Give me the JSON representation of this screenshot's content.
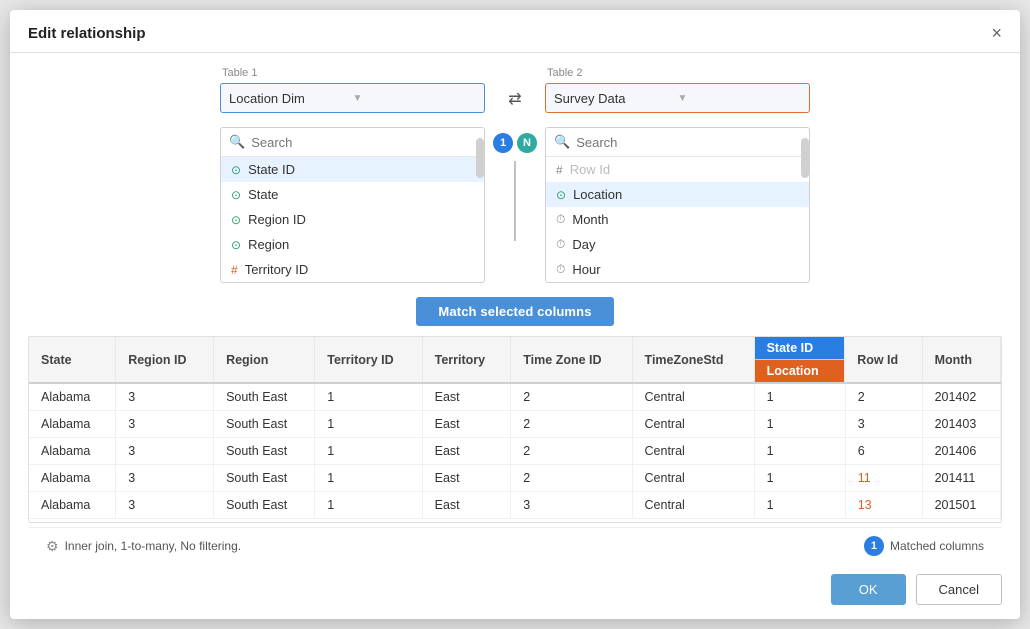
{
  "modal": {
    "title": "Edit relationship",
    "close_label": "×"
  },
  "table1": {
    "label": "Table 1",
    "value": "Location Dim"
  },
  "table2": {
    "label": "Table 2",
    "value": "Survey Data"
  },
  "left_panel": {
    "search_placeholder": "Search",
    "columns": [
      {
        "type": "geo",
        "name": "State ID"
      },
      {
        "type": "geo",
        "name": "State"
      },
      {
        "type": "geo",
        "name": "Region ID"
      },
      {
        "type": "geo",
        "name": "Region"
      },
      {
        "type": "hash",
        "name": "Territory ID"
      }
    ]
  },
  "right_panel": {
    "search_placeholder": "Search",
    "columns": [
      {
        "type": "number",
        "name": "Row Id",
        "dimmed": true
      },
      {
        "type": "geo",
        "name": "Location"
      },
      {
        "type": "clock",
        "name": "Month"
      },
      {
        "type": "clock",
        "name": "Day"
      },
      {
        "type": "clock",
        "name": "Hour"
      }
    ]
  },
  "match_button_label": "Match selected columns",
  "table_columns": [
    "State",
    "Region ID",
    "Region",
    "Territory ID",
    "Territory",
    "Time Zone ID",
    "TimeZoneStd",
    "State ID / Location",
    "Row Id",
    "Month"
  ],
  "table_rows": [
    [
      "Alabama",
      "3",
      "South East",
      "1",
      "East",
      "2",
      "Central",
      "1",
      "2",
      "201402"
    ],
    [
      "Alabama",
      "3",
      "South East",
      "1",
      "East",
      "2",
      "Central",
      "1",
      "3",
      "201403"
    ],
    [
      "Alabama",
      "3",
      "South East",
      "1",
      "East",
      "2",
      "Central",
      "1",
      "6",
      "201406"
    ],
    [
      "Alabama",
      "3",
      "South East",
      "1",
      "East",
      "2",
      "Central",
      "1",
      "11",
      "201411"
    ],
    [
      "Alabama",
      "3",
      "South East",
      "1",
      "East",
      "3",
      "Central",
      "1",
      "13",
      "201501"
    ]
  ],
  "join_info": "Inner join, 1-to-many, No filtering.",
  "matched_columns_label": "Matched columns",
  "matched_columns_count": "1",
  "ok_label": "OK",
  "cancel_label": "Cancel",
  "badge1": "1",
  "badge2": "N"
}
